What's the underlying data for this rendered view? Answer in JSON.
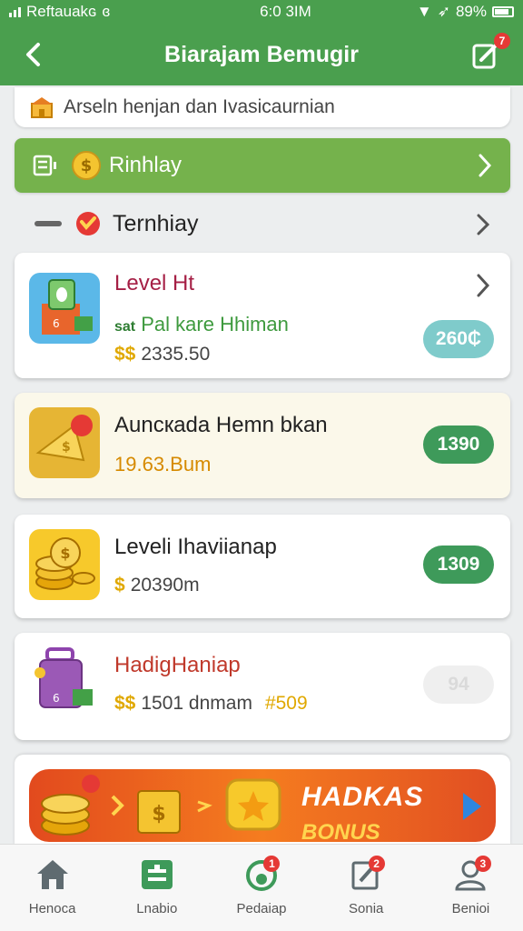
{
  "status": {
    "carrier": "Reftauakɢ",
    "time": "6:0 3IM",
    "battery": "89%"
  },
  "header": {
    "title": "Biarajam Bemugir",
    "edit_badge": "7"
  },
  "notice": {
    "text": "Arseln henjan dan Ivasicaurnian"
  },
  "rinhlay": {
    "label": "Rinhlay"
  },
  "section": {
    "label": "Ternhiay"
  },
  "cards": [
    {
      "title": "Level Ht",
      "subtitle": "Pal kare Hhiman",
      "sub_prefix": "sat",
      "amount": "2335.50",
      "pill": "260₵",
      "pill_color": "#7FCBCB"
    },
    {
      "title": "Auncкada Hemn bkan",
      "subtitle": "19.63.Bum",
      "pill": "1390",
      "pill_color": "#3E9A5A"
    },
    {
      "title": "Leveli Ihaviianap",
      "amount": "20390m",
      "pill": "1309",
      "pill_color": "#3E9A5A"
    },
    {
      "title": "HadigHaniap",
      "amount": "1501 dnmam",
      "extra": "#509",
      "pill": "94",
      "pill_color": "#EFEFEF"
    }
  ],
  "banner": {
    "line1": "HADKAS",
    "line2": "BONUS"
  },
  "tabs": [
    {
      "label": "Henoca",
      "badge": ""
    },
    {
      "label": "Lnabio",
      "badge": ""
    },
    {
      "label": "Pedaiap",
      "badge": "1"
    },
    {
      "label": "Sonia",
      "badge": "2"
    },
    {
      "label": "Benioi",
      "badge": "3"
    }
  ],
  "colors": {
    "brand_green": "#4A9F4E",
    "accent_green": "#75B24C",
    "title_red": "#A51F45",
    "orange": "#F57C1F"
  }
}
